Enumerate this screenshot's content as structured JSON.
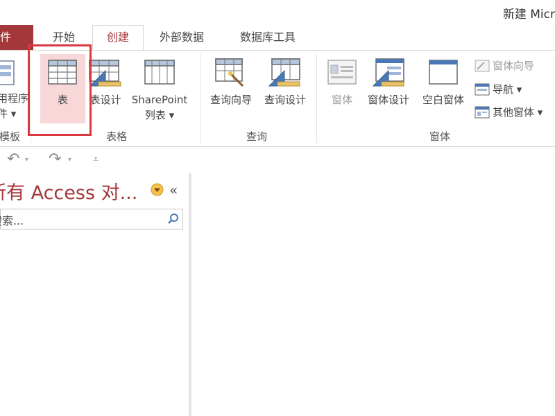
{
  "window": {
    "title": "新建 Micr"
  },
  "tabs": {
    "file": "文件",
    "home": "开始",
    "create": "创建",
    "external": "外部数据",
    "dbtools": "数据库工具"
  },
  "ribbon": {
    "templates": {
      "app_parts_line1": "用程序",
      "app_parts_line2": "件 ▾",
      "label": "模板"
    },
    "tables": {
      "label": "表格",
      "table": "表",
      "table_design": "表设计",
      "sharepoint_line1": "SharePoint",
      "sharepoint_line2": "列表 ▾"
    },
    "queries": {
      "label": "查询",
      "wizard": "查询向导",
      "design": "查询设计"
    },
    "forms": {
      "label": "窗体",
      "form": "窗体",
      "form_design": "窗体设计",
      "blank_form": "空白窗体",
      "form_wizard": "窗体向导",
      "navigation": "导航 ▾",
      "more_forms": "其他窗体 ▾"
    }
  },
  "qat": {
    "undo": "↶",
    "redo": "↷",
    "dropdown_glyph": "▾",
    "customize": "⩡"
  },
  "nav": {
    "header": "所有 Access 对...",
    "search_placeholder": "搜索...",
    "collapse": "«"
  },
  "colors": {
    "accent": "#a4373a",
    "highlight": "#d9383e",
    "selected_fill": "#f8d7d8"
  }
}
